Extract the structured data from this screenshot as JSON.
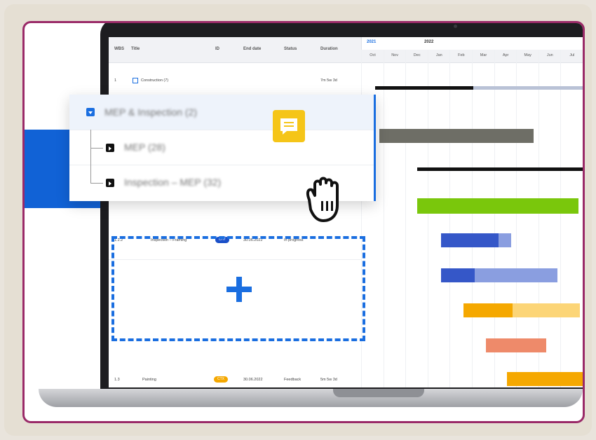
{
  "table": {
    "headers": {
      "wbs": "WBS",
      "title": "Title",
      "id": "ID",
      "end_date": "End date",
      "status": "Status",
      "duration": "Duration"
    },
    "rows": [
      {
        "wbs": "1",
        "title": "Construction (7)",
        "duration": "7m 5w 3d"
      },
      {
        "wbs": "1.2.2",
        "title": "Inspection – Framing",
        "badge": "CHT",
        "end_date": "30.06.2022",
        "status": "In progress"
      },
      {
        "wbs": "1.3",
        "title": "Painting",
        "badge": "CTX",
        "end_date": "30.06.2022",
        "status": "Feedback",
        "duration": "5m 5w 3d"
      }
    ]
  },
  "gantt": {
    "years": [
      "2021",
      "2022"
    ],
    "months": [
      "Oct",
      "Nov",
      "Dec",
      "Jan",
      "Feb",
      "Mar",
      "Apr",
      "May",
      "Jun",
      "Jul"
    ]
  },
  "popup": {
    "rows": [
      {
        "label": "MEP & Inspection (2)"
      },
      {
        "label": "MEP (28)"
      },
      {
        "label": "Inspection – MEP (32)"
      }
    ]
  },
  "colors": {
    "frame": "#9a2a68",
    "accent": "#1a6ee0",
    "green": "#7ac70c",
    "gray_bar": "#6e6e66",
    "blue": "#3557c8",
    "blue_light": "#8a9ee0",
    "orange": "#f5a800",
    "orange_light": "#fcd577",
    "salmon": "#ee8a6a",
    "comment": "#f5c518"
  },
  "icons": [
    "comment-icon",
    "hand-cursor-icon",
    "plus-icon",
    "collapse-chevron-icon",
    "expand-chevron-icon"
  ]
}
